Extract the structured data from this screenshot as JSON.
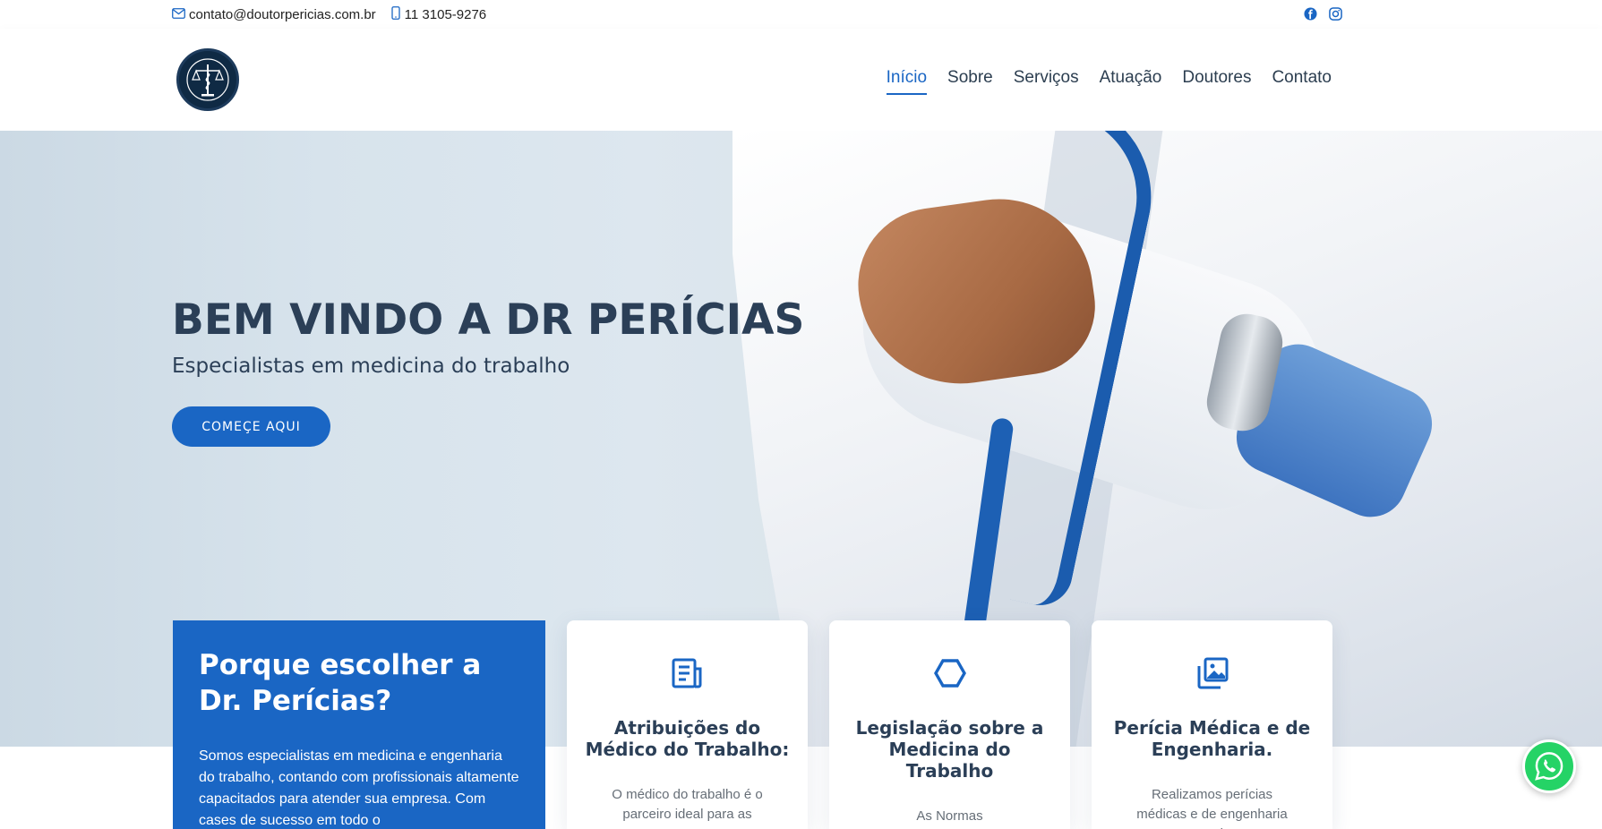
{
  "topbar": {
    "email": "contato@doutorpericias.com.br",
    "phone": "11 3105-9276",
    "icons": [
      "envelope-icon",
      "phone-icon",
      "facebook-icon",
      "instagram-icon"
    ]
  },
  "header": {
    "logo_icon": "scales-caduceus-logo",
    "nav": [
      {
        "label": "Início",
        "active": true
      },
      {
        "label": "Sobre",
        "active": false
      },
      {
        "label": "Serviços",
        "active": false
      },
      {
        "label": "Atuação",
        "active": false
      },
      {
        "label": "Doutores",
        "active": false
      },
      {
        "label": "Contato",
        "active": false
      }
    ]
  },
  "hero": {
    "title": "BEM VINDO A DR PERÍCIAS",
    "subtitle": "Especialistas em medicina do trabalho",
    "cta_label": "COMEÇE AQUI"
  },
  "why": {
    "title": "Porque escolher a Dr. Perícias?",
    "text": "Somos especialistas em medicina e engenharia do trabalho, contando com profissionais altamente capacitados para atender sua empresa. Com cases de sucesso em todo o"
  },
  "cards": [
    {
      "icon": "document-icon",
      "title": "Atribuições do Médico do Trabalho:",
      "text": "O médico do trabalho é o parceiro ideal para as"
    },
    {
      "icon": "hexagon-icon",
      "title": "Legislação sobre a Medicina do Trabalho",
      "text": "As Normas Regulamentadoras de"
    },
    {
      "icon": "images-icon",
      "title": "Perícia Médica e de Engenharia.",
      "text": "Realizamos perícias médicas e de engenharia em todo o"
    }
  ],
  "colors": {
    "accent": "#1a66c4",
    "heading": "#2b3f57",
    "whatsapp": "#25d366"
  }
}
